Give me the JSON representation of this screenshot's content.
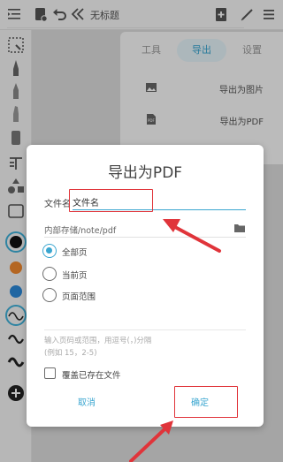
{
  "topbar": {
    "title": "无标题",
    "icons": [
      "outline-icon",
      "save-icon",
      "undo-icon",
      "collapse-chevrons-icon",
      "add-page-icon",
      "pen-icon",
      "more-icon"
    ]
  },
  "leftbar": {
    "tools": [
      "select-lasso-icon",
      "pen-tool-icon",
      "pencil-tool-icon",
      "marker-tool-icon",
      "eraser-tool-icon",
      "text-tool-icon",
      "shapes-tool-icon",
      "image-tool-icon"
    ],
    "colors": [
      "#111111",
      "#f0882e",
      "#2b88d8"
    ],
    "strokes": [
      "wave-stroke-icon",
      "wave-stroke-icon",
      "wave-stroke-icon"
    ],
    "add_icon": "add-circle-icon"
  },
  "panel": {
    "tabs": [
      {
        "label": "工具",
        "active": false
      },
      {
        "label": "导出",
        "active": true
      },
      {
        "label": "设置",
        "active": false
      }
    ],
    "items": [
      {
        "label": "导出为图片",
        "icon": "image-icon"
      },
      {
        "label": "导出为PDF",
        "icon": "pdf-icon"
      }
    ]
  },
  "dialog": {
    "title": "导出为PDF",
    "filename_label": "文件名",
    "filename_value": "文件名",
    "path": "内部存储/note/pdf",
    "options": [
      {
        "label": "全部页",
        "checked": true
      },
      {
        "label": "当前页",
        "checked": false
      },
      {
        "label": "页面范围",
        "checked": false
      }
    ],
    "range_hint_line1": "输入页码或范围，用逗号(，)分隔",
    "range_hint_line2": "(例如 15，2-5)",
    "overwrite_label": "覆盖已存在文件",
    "overwrite_checked": false,
    "cancel_label": "取消",
    "confirm_label": "确定"
  },
  "colors": {
    "accent": "#3aa6d0",
    "annotation_red": "#e0343a"
  }
}
